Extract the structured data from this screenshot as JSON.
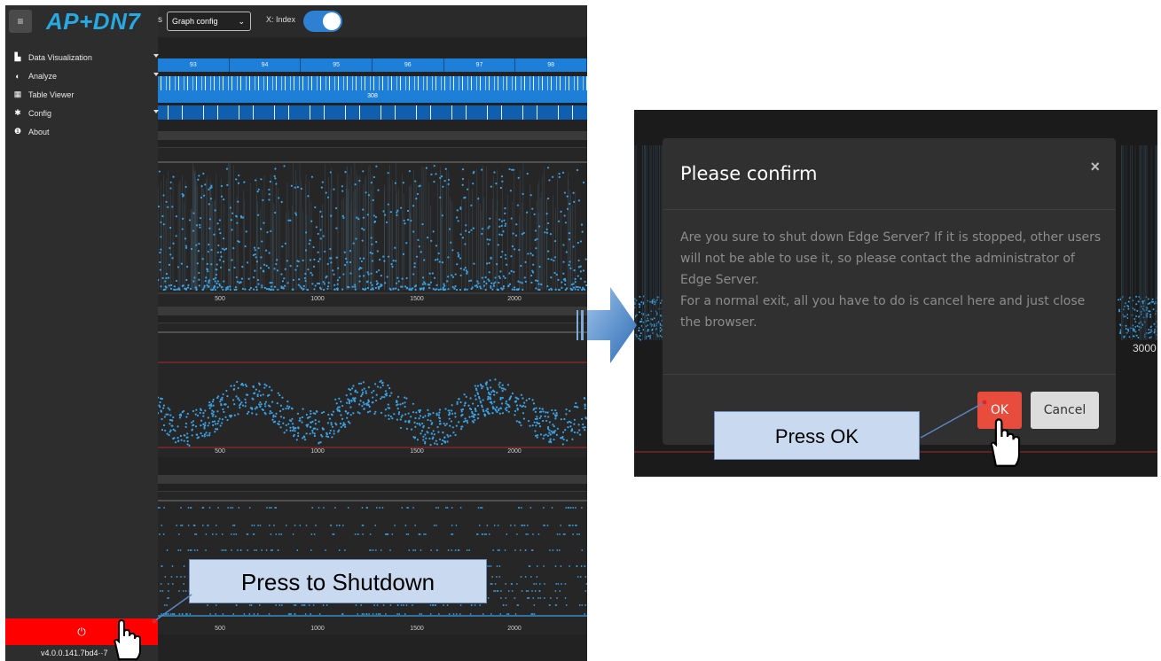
{
  "app": {
    "logo": "AP+DN7",
    "menu_icon": "≡",
    "version": "v4.0.0.141.7bd4··7"
  },
  "sidebar": {
    "items": [
      {
        "label": "Data Visualization",
        "icon": "chart-icon",
        "glyph": "▙"
      },
      {
        "label": "Analyze",
        "icon": "brain-icon",
        "glyph": "◐"
      },
      {
        "label": "Table Viewer",
        "icon": "table-icon",
        "glyph": "▦"
      },
      {
        "label": "Config",
        "icon": "gear-icon",
        "glyph": "✱"
      },
      {
        "label": "About",
        "icon": "info-icon",
        "glyph": "❶"
      }
    ],
    "shutdown_glyph": "⏻"
  },
  "topbar": {
    "prefix": "s",
    "graph_config_value": "Graph config",
    "x_axis_label": "X: Index",
    "x_index_toggle_on": true
  },
  "timeline": {
    "row1_labels": [
      "93",
      "94",
      "95",
      "96",
      "97",
      "98"
    ],
    "row3_label": "308"
  },
  "charts": {
    "x_ticks": [
      "500",
      "1000",
      "1500",
      "2000"
    ],
    "point_color": "#3aa3e8",
    "limit_color": "#d9302c"
  },
  "annotations": {
    "shutdown_callout": "Press to Shutdown",
    "ok_callout": "Press OK"
  },
  "dialog": {
    "title": "Please confirm",
    "close_glyph": "×",
    "body_lines": [
      "Are you sure to shut down Edge Server? If it is stopped, other users",
      "will not be able to use it, so please contact the administrator of",
      "Edge Server.",
      "For a normal exit, all you have to do is cancel here and just close",
      "the browser."
    ],
    "ok_label": "OK",
    "cancel_label": "Cancel",
    "ok_color": "#e74c3c",
    "background_axis_tick": "3000"
  }
}
